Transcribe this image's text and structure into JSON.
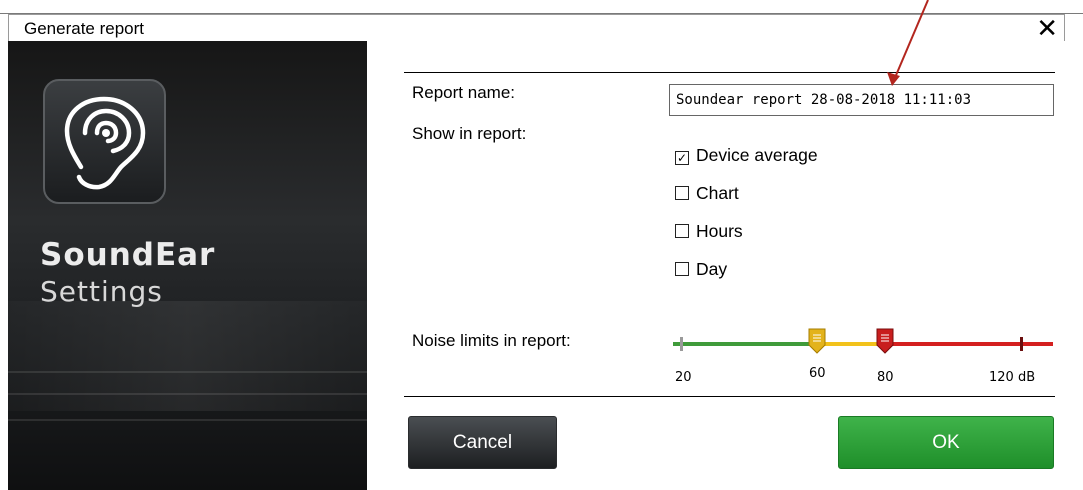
{
  "window": {
    "title": "Generate report",
    "close_glyph": "✕"
  },
  "brand": {
    "name": "SoundEar",
    "subtitle": "Settings",
    "icon": "ear-icon"
  },
  "form": {
    "report_name_label": "Report name:",
    "report_name_value": "Soundear report 28-08-2018 11:11:03",
    "show_label": "Show in report:",
    "options": [
      {
        "label": "Device average",
        "checked": true
      },
      {
        "label": "Chart",
        "checked": false
      },
      {
        "label": "Hours",
        "checked": false
      },
      {
        "label": "Day",
        "checked": false
      }
    ],
    "noise_label": "Noise limits in report:",
    "noise": {
      "min": 20,
      "max": 120,
      "lower_limit": 60,
      "upper_limit": 80,
      "tick_labels": [
        "20",
        "60",
        "80",
        "120 dB"
      ],
      "colors": {
        "green": "#3f9b3a",
        "yellow": "#f2c21b",
        "red": "#d42020"
      }
    }
  },
  "buttons": {
    "cancel": "Cancel",
    "ok": "OK"
  },
  "annotation": {
    "arrow_color": "#b3261e"
  }
}
